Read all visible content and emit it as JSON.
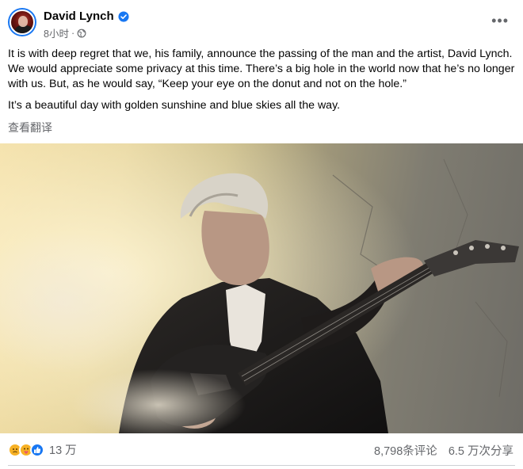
{
  "post": {
    "author": "David Lynch",
    "verified_icon": "verified-badge-icon",
    "time": "8小时",
    "separator": "·",
    "audience_icon": "globe-icon",
    "more_icon": "more-options-icon",
    "more_label": "•••",
    "paragraphs": [
      "It is with deep regret that we, his family, announce the passing of the man and the artist, David Lynch.  We would appreciate some privacy at this time.  There’s a big hole in the world now that he’s no longer with us.  But, as he would say, “Keep your eye on the donut and not on the hole.”",
      "It’s a beautiful day with golden sunshine and blue skies all the way."
    ],
    "see_translation": "查看翻译"
  },
  "photo": {
    "description_icon": "post-photo"
  },
  "footer": {
    "reactions": [
      "sad-reaction-icon",
      "care-reaction-icon",
      "like-reaction-icon"
    ],
    "reaction_count": "13 万",
    "comments": "8,798条评论",
    "shares": "6.5 万次分享"
  },
  "colors": {
    "accent": "#1877f2",
    "secondary_text": "#65676b"
  }
}
